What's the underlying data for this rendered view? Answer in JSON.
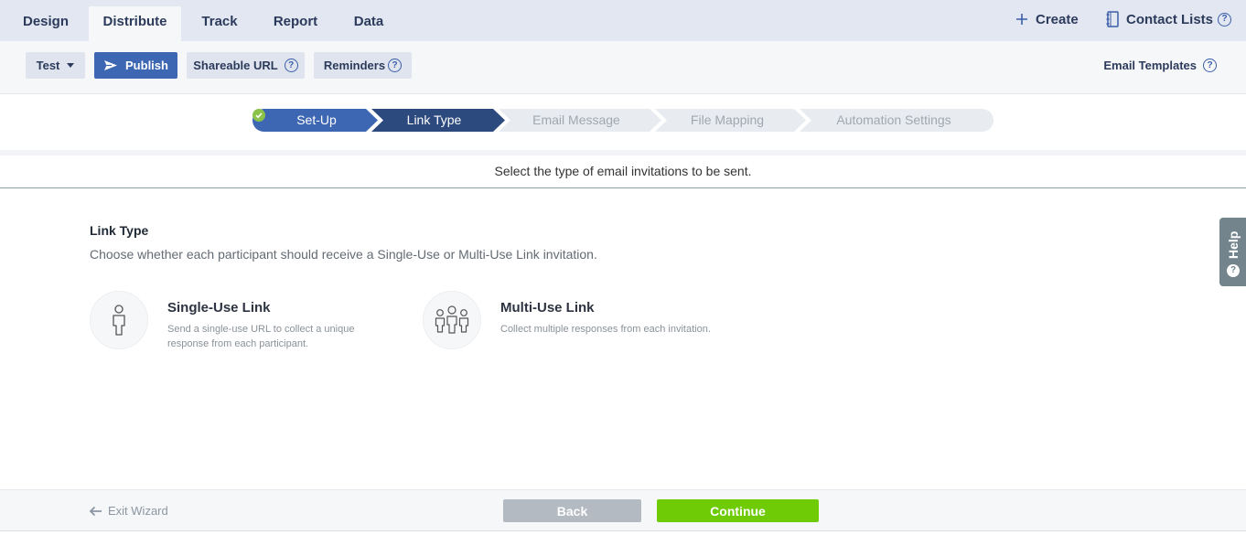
{
  "topnav": {
    "tabs": [
      "Design",
      "Distribute",
      "Track",
      "Report",
      "Data"
    ],
    "active_tab": "Distribute",
    "create_label": "Create",
    "contact_lists_label": "Contact Lists"
  },
  "toolbar": {
    "test_label": "Test",
    "publish_label": "Publish",
    "shareable_url_label": "Shareable URL",
    "reminders_label": "Reminders",
    "email_templates_label": "Email Templates"
  },
  "stepper": {
    "steps": [
      "Set-Up",
      "Link Type",
      "Email Message",
      "File Mapping",
      "Automation Settings"
    ],
    "current_step": "Link Type",
    "completed_steps": [
      "Set-Up"
    ]
  },
  "instruction": "Select the type of email invitations to be sent.",
  "link_type": {
    "title": "Link Type",
    "description": "Choose whether each participant should receive a Single-Use or Multi-Use Link invitation.",
    "options": [
      {
        "title": "Single-Use Link",
        "description": "Send a single-use URL to collect a unique response from each participant.",
        "icon": "single-person-icon"
      },
      {
        "title": "Multi-Use Link",
        "description": "Collect multiple responses from each invitation.",
        "icon": "group-people-icon"
      }
    ]
  },
  "help_tab": {
    "label": "Help"
  },
  "footer": {
    "exit_label": "Exit Wizard",
    "back_label": "Back",
    "continue_label": "Continue"
  },
  "colors": {
    "primary": "#3d66b3",
    "active_step": "#2c4a7e",
    "pending_step": "#e8ebef",
    "continue": "#6ecb06",
    "back": "#b3bac2",
    "check": "#8bc34a"
  }
}
